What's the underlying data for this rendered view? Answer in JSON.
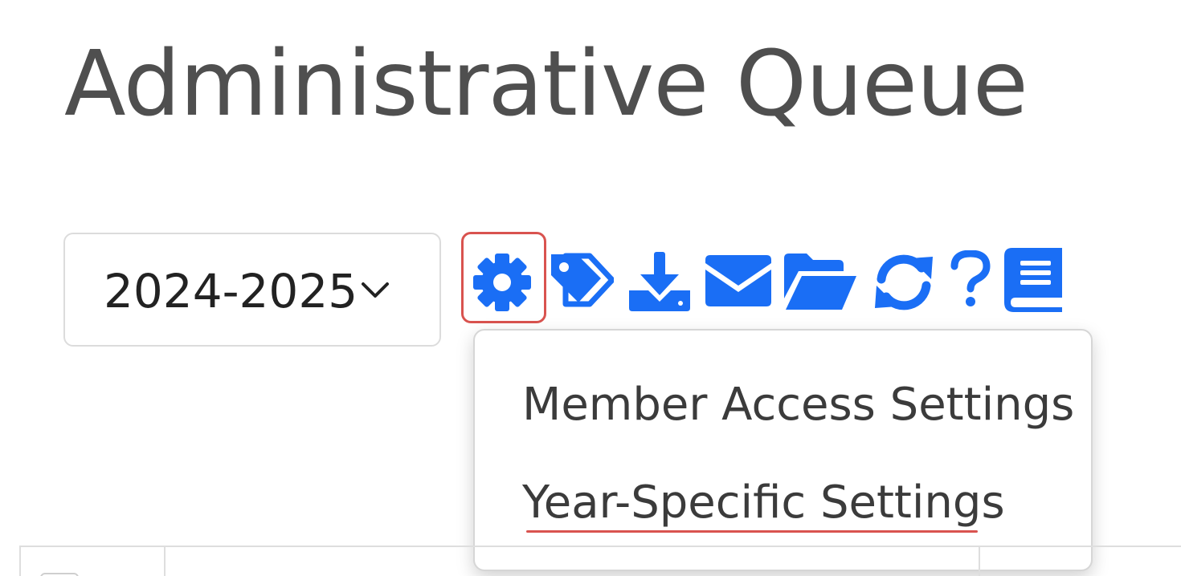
{
  "page": {
    "title": "Administrative Queue"
  },
  "toolbar": {
    "year_select": {
      "value": "2024-2025"
    },
    "icons": [
      {
        "name": "gear-icon"
      },
      {
        "name": "tags-icon"
      },
      {
        "name": "download-icon"
      },
      {
        "name": "envelope-icon"
      },
      {
        "name": "folder-open-icon"
      },
      {
        "name": "refresh-icon"
      },
      {
        "name": "question-icon"
      },
      {
        "name": "book-icon"
      }
    ],
    "icon_color": "#1a6ef5"
  },
  "dropdown": {
    "items": [
      {
        "label": "Member Access Settings"
      },
      {
        "label": "Year-Specific Settings"
      }
    ]
  },
  "annotation_color": "#d9534f"
}
